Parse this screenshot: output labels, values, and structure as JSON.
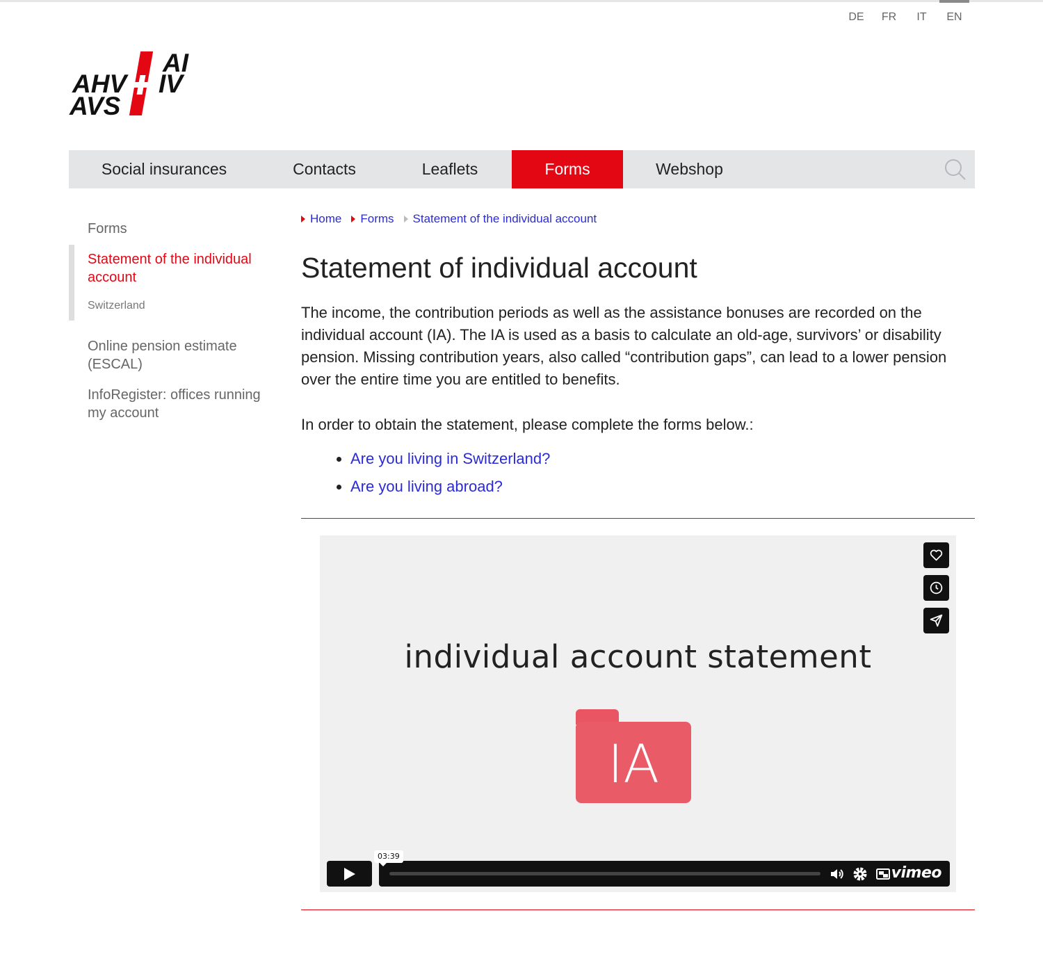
{
  "languages": [
    "DE",
    "FR",
    "IT",
    "EN"
  ],
  "active_language": "EN",
  "logo": {
    "line1_left": "AHV",
    "line2_left": "AVS",
    "line1_right": "AI",
    "line2_right": "IV"
  },
  "nav": {
    "items": [
      "Social insurances",
      "Contacts",
      "Leaflets",
      "Forms",
      "Webshop"
    ],
    "active": "Forms",
    "search_icon": "search-icon"
  },
  "sidebar": {
    "heading": "Forms",
    "active_item": "Statement of the individual account",
    "active_sub": "Switzerland",
    "items": [
      "Online pension estimate (ESCAL)",
      "InfoRegister: offices running my account"
    ]
  },
  "breadcrumb": [
    "Home",
    "Forms",
    "Statement of the individual account"
  ],
  "page_title": "Statement of individual account",
  "intro": "The income, the contribution periods as well as the assistance bonuses are recorded on the individual account (IA). The IA is used as a basis to calculate an old-age, survivors’ or disability pension. Missing contribution years, also called “contribution gaps”, can lead to a lower pension over the entire time you are entitled to benefits.",
  "lead": "In order to obtain the statement, please complete the forms below.:",
  "links": [
    "Are you living in Switzerland?",
    "Are you living abroad?"
  ],
  "video": {
    "title": "individual account statement",
    "folder_label": "IA",
    "duration": "03:39",
    "brand": "vimeo",
    "side_buttons": [
      "heart-icon",
      "clock-icon",
      "send-icon"
    ],
    "control_icons": [
      "volume-icon",
      "settings-gear-icon",
      "pip-icon"
    ]
  },
  "colors": {
    "accent": "#e30613",
    "link": "#2b2bd6",
    "nav_bg": "#e3e5e7"
  }
}
